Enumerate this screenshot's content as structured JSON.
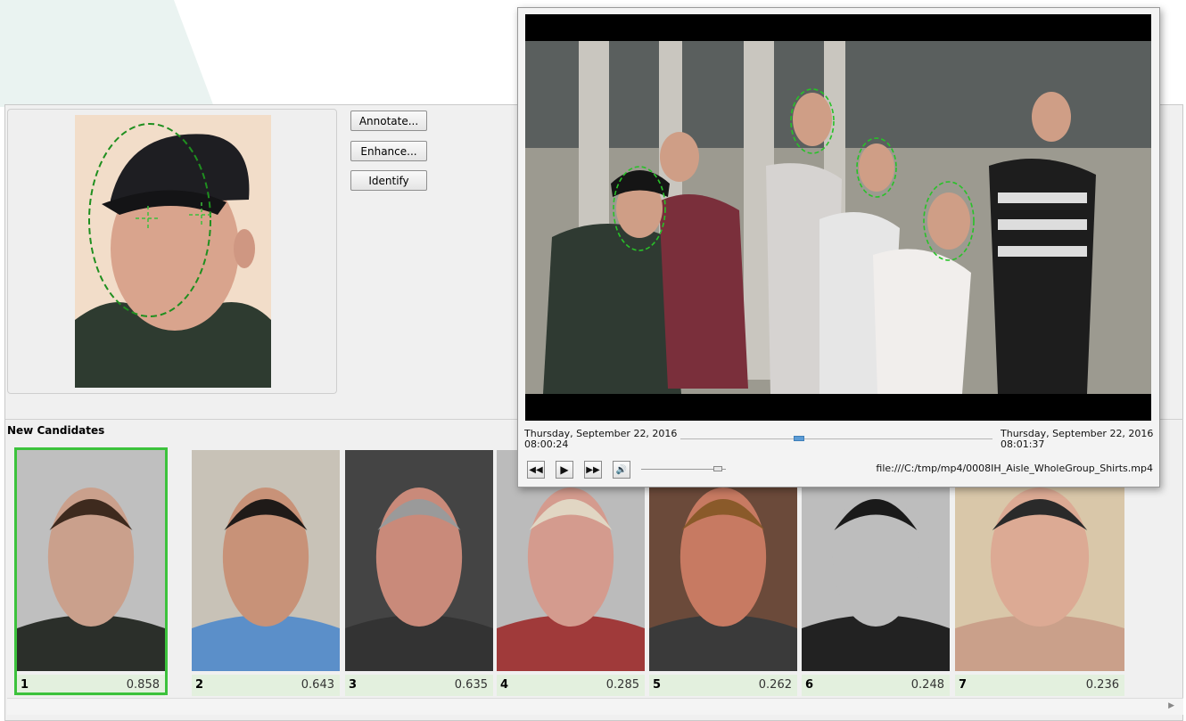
{
  "query": {
    "buttons": {
      "annotate": "Annotate...",
      "enhance": "Enhance...",
      "identify": "Identify"
    }
  },
  "candidates_section": {
    "title": "New Candidates",
    "items": [
      {
        "rank": "1",
        "score": "0.858",
        "selected": true
      },
      {
        "rank": "2",
        "score": "0.643",
        "selected": false
      },
      {
        "rank": "3",
        "score": "0.635",
        "selected": false
      },
      {
        "rank": "4",
        "score": "0.285",
        "selected": false
      },
      {
        "rank": "5",
        "score": "0.262",
        "selected": false
      },
      {
        "rank": "6",
        "score": "0.248",
        "selected": false
      },
      {
        "rank": "7",
        "score": "0.236",
        "selected": false
      }
    ]
  },
  "video_player": {
    "start_time": {
      "date": "Thursday, September 22, 2016",
      "time": "08:00:24"
    },
    "end_time": {
      "date": "Thursday, September 22, 2016",
      "time": "08:01:37"
    },
    "file": "file:///C:/tmp/mp4/0008IH_Aisle_WholeGroup_Shirts.mp4",
    "controls": {
      "rewind": "rewind-icon",
      "play": "play-icon",
      "fast_forward": "fast-forward-icon",
      "volume": "speaker-icon"
    },
    "playback_position": 0.38,
    "volume_level": 0.9
  },
  "colors": {
    "selection_border": "#3cc23c",
    "face_overlay": "#22aa22",
    "score_bar": "#e3f0de"
  }
}
